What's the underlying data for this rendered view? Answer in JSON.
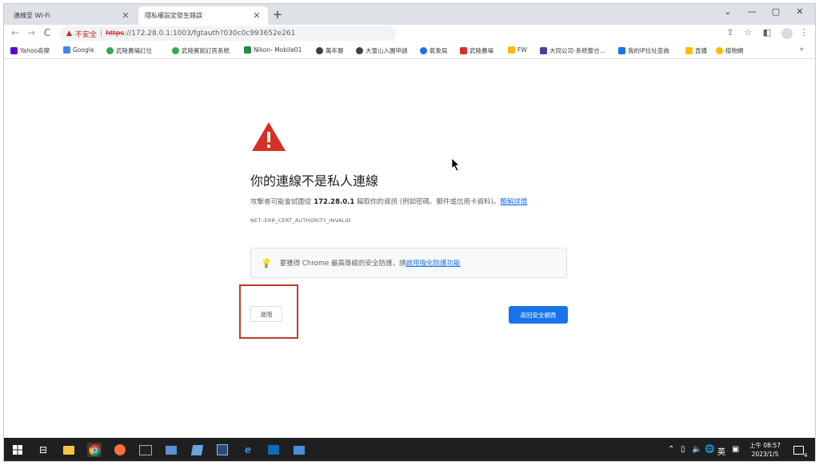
{
  "tabs": [
    {
      "title": "連線至 Wi-Fi",
      "close": "✕"
    },
    {
      "title": "隱私權設定發生錯誤",
      "close": "✕"
    }
  ],
  "newtab": "+",
  "window_controls": {
    "dropdown": "⌄",
    "minimize": "—",
    "restore": "▢",
    "close": "✕"
  },
  "toolbar": {
    "back": "←",
    "forward": "→",
    "reload": "C",
    "insecure_label": "不安全",
    "separator": "|",
    "url_scheme": "https",
    "url_rest": "://172.28.0.1:1003/fgtauth?030c0c993652e261",
    "share": "⇪",
    "star": "☆",
    "sidepanel": "◧",
    "menu": "⋮"
  },
  "bookmarks": {
    "items": [
      {
        "label": "Yahoo奇摩",
        "color": "#6001d2"
      },
      {
        "label": "Google",
        "color": "#4285f4"
      },
      {
        "label": "武陵農場訂位",
        "color": "#34a853"
      },
      {
        "label": "武陵賓館訂房系統",
        "color": "#34a853"
      },
      {
        "label": "Nikon- Mobile01",
        "color": "#1e8e3e"
      },
      {
        "label": "萬年曆",
        "color": "#3c4043"
      },
      {
        "label": "大雪山入園申請",
        "color": "#3c4043"
      },
      {
        "label": "氣象局",
        "color": "#1a73e8"
      },
      {
        "label": "武陵農場",
        "color": "#d93025"
      },
      {
        "label": "FW",
        "color": "#fbbc04"
      },
      {
        "label": "大同公司-系統整合...",
        "color": "#4b3f9c"
      },
      {
        "label": "我的IP位址查詢",
        "color": "#1a73e8"
      },
      {
        "label": "直播",
        "color": "#fbbc04"
      },
      {
        "label": "植物網",
        "color": "#fbbc04"
      }
    ],
    "more": "»"
  },
  "page": {
    "title": "你的連線不是私人連線",
    "desc_before": "攻擊者可能會試圖從 ",
    "desc_host": "172.28.0.1",
    "desc_after": " 竊取你的資訊 (例如密碼、郵件或信用卡資料)。",
    "learn_more": "瞭解詳情",
    "error_code": "NET::ERR_CERT_AUTHORITY_INVALID",
    "tip_text": "要獲得 Chrome 最高等級的安全防護，請",
    "tip_link": "啟用強化防護功能",
    "advanced_button": "進階",
    "back_button": "返回安全網頁"
  },
  "taskbar": {
    "tray_caret": "⌃",
    "tray_volume": "🔈",
    "tray_network": "🌐",
    "ime": "英",
    "time": "上午 08:57",
    "date": "2023/1/5",
    "notification": "4"
  },
  "colors": {
    "accent": "#1a73e8",
    "warning_red": "#c5221f",
    "highlight_box": "#c0392b",
    "triangle": "#d93025"
  }
}
